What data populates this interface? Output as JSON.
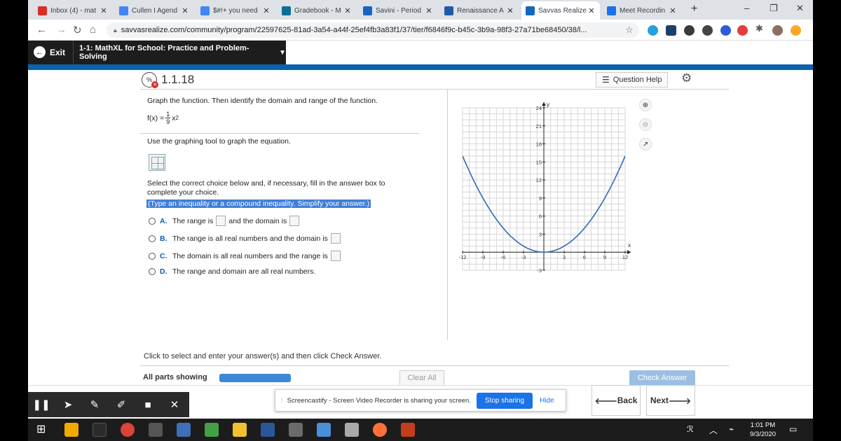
{
  "browser": {
    "tabs": [
      {
        "title": "Inbox (4) - mat",
        "icon": "gmail-icon",
        "color": "#d93025"
      },
      {
        "title": "Cullen I Agend",
        "icon": "docs-icon",
        "color": "#4285f4"
      },
      {
        "title": "$#!+ you need",
        "icon": "docs-icon",
        "color": "#4285f4"
      },
      {
        "title": "Gradebook - M",
        "icon": "pearson-icon",
        "color": "#0b6e99"
      },
      {
        "title": "Savini - Period",
        "icon": "classroom-icon",
        "color": "#1565c0"
      },
      {
        "title": "Renaissance A",
        "icon": "renaissance-icon",
        "color": "#1e5aa8"
      },
      {
        "title": "Savvas Realize",
        "icon": "savvas-icon",
        "color": "#1565c0"
      },
      {
        "title": "Meet Recordin",
        "icon": "drive-icon",
        "color": "#1a73e8"
      }
    ],
    "active_tab": 6,
    "url": "savvasrealize.com/community/program/22597625-81ad-3a54-a44f-25ef4fb3a83f1/37/tier/f6846f9c-b45c-3b9a-98f3-27a71be68450/38/l..."
  },
  "appbar": {
    "exit_label": "Exit",
    "course_label": "1-1: MathXL for School: Practice and Problem-Solving"
  },
  "question": {
    "number": "1.1.18",
    "help_label": "Question Help",
    "prompt": "Graph the function. Then identify the domain and range of the function.",
    "function_prefix": "f(x) =",
    "function_num": "1",
    "function_den": "9",
    "function_var": "x",
    "function_exp": "2",
    "instruction": "Use the graphing tool to graph the equation.",
    "choose_text": "Select the correct choice below and, if necessary, fill in the answer box to complete your choice.",
    "hint": "(Type an inequality or a compound inequality. Simplify your answer.)",
    "options": [
      {
        "letter": "A.",
        "text_a": "The range is",
        "text_b": "and the domain is"
      },
      {
        "letter": "B.",
        "text_a": "The range is all real numbers and the domain is"
      },
      {
        "letter": "C.",
        "text_a": "The domain is all real numbers and the range is"
      },
      {
        "letter": "D.",
        "text_a": "The range and domain are all real numbers."
      }
    ],
    "footer_msg": "Click to select and enter your answer(s) and then click Check Answer.",
    "all_parts_label": "All parts showing",
    "progress": 1.0,
    "clear_all_label": "Clear All",
    "check_answer_label": "Check Answer"
  },
  "chart_data": {
    "type": "line",
    "function": "f(x) = (1/9)x^2",
    "xlabel": "x",
    "ylabel": "y",
    "xlim": [
      -12,
      12
    ],
    "ylim": [
      -3,
      24
    ],
    "x_ticks": [
      "-12",
      "-9",
      "-6",
      "-3",
      "3",
      "6",
      "9",
      "12"
    ],
    "y_ticks": [
      "-3",
      "3",
      "6",
      "9",
      "12",
      "15",
      "18",
      "21",
      "24"
    ],
    "grid": true,
    "series": [
      {
        "x": [
          -14,
          -12,
          -9,
          -6,
          -3,
          0,
          3,
          6,
          9,
          12,
          14
        ],
        "y": [
          21.78,
          16,
          9,
          4,
          1,
          0,
          1,
          4,
          9,
          16,
          21.78
        ]
      }
    ],
    "line_color": "#2f6db5"
  },
  "nav": {
    "back_label": "Back",
    "next_label": "Next"
  },
  "screencast": {
    "message": "Screencastify - Screen Video Recorder is sharing your screen.",
    "stop_label": "Stop sharing",
    "hide_label": "Hide"
  },
  "taskbar": {
    "time": "1:01 PM",
    "date": "9/3/2020"
  }
}
